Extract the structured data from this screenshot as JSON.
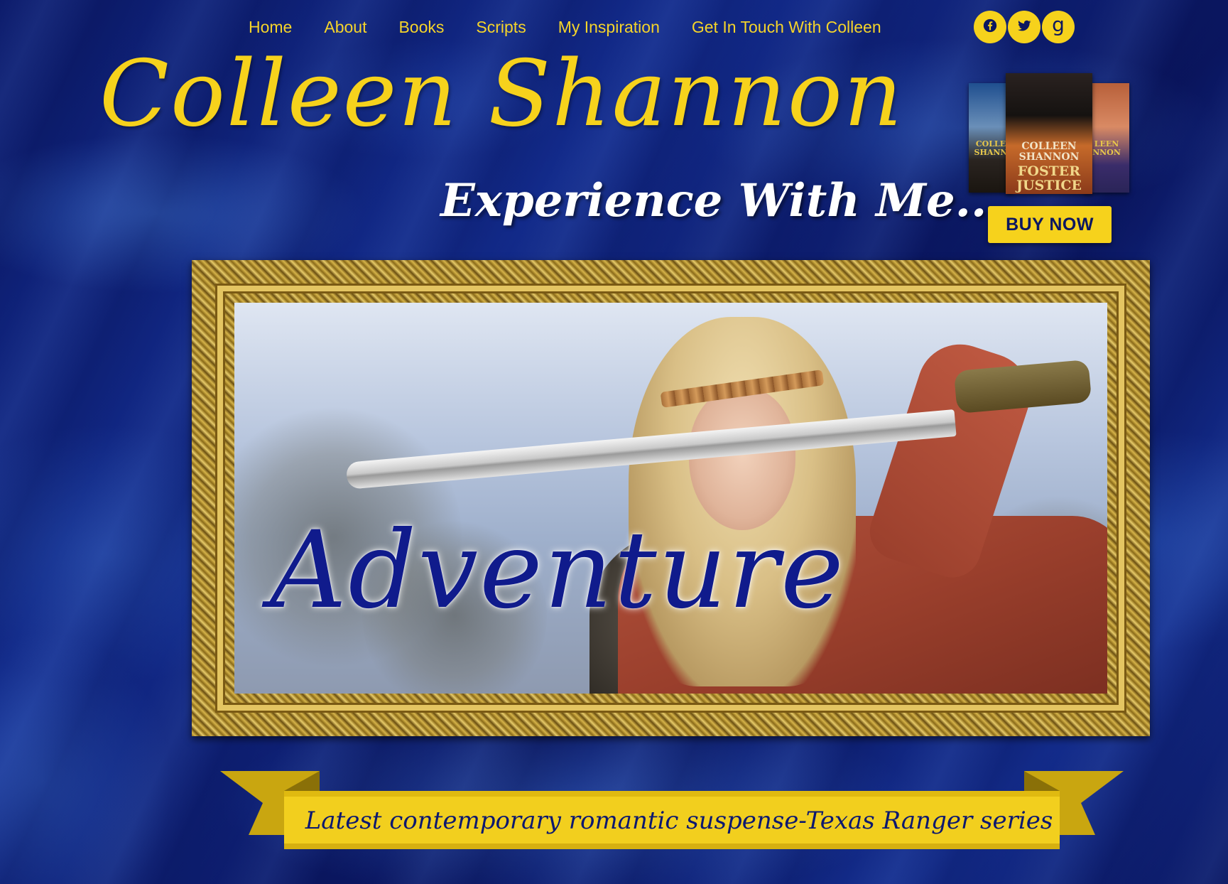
{
  "nav": {
    "items": [
      {
        "label": "Home"
      },
      {
        "label": "About"
      },
      {
        "label": "Books"
      },
      {
        "label": "Scripts"
      },
      {
        "label": "My Inspiration"
      },
      {
        "label": "Get In Touch With Colleen"
      }
    ]
  },
  "social": [
    {
      "icon": "facebook-icon"
    },
    {
      "icon": "twitter-icon"
    },
    {
      "icon": "goodreads-icon",
      "glyph": "g"
    }
  ],
  "header": {
    "title": "Colleen Shannon",
    "tagline": "Experience With Me..."
  },
  "promo": {
    "covers": {
      "left_text": "COLLE SHANN",
      "middle_author": "COLLEEN SHANNON",
      "middle_title": "FOSTER JUSTICE",
      "right_text": "LEEN NNON"
    },
    "buy_label": "BUY NOW"
  },
  "hero": {
    "word": "Adventure"
  },
  "ribbon": {
    "text": "Latest contemporary romantic suspense-Texas Ranger series"
  },
  "colors": {
    "accent": "#f6d21c",
    "background": "#0b1a66",
    "hero_text": "#101b8c"
  }
}
